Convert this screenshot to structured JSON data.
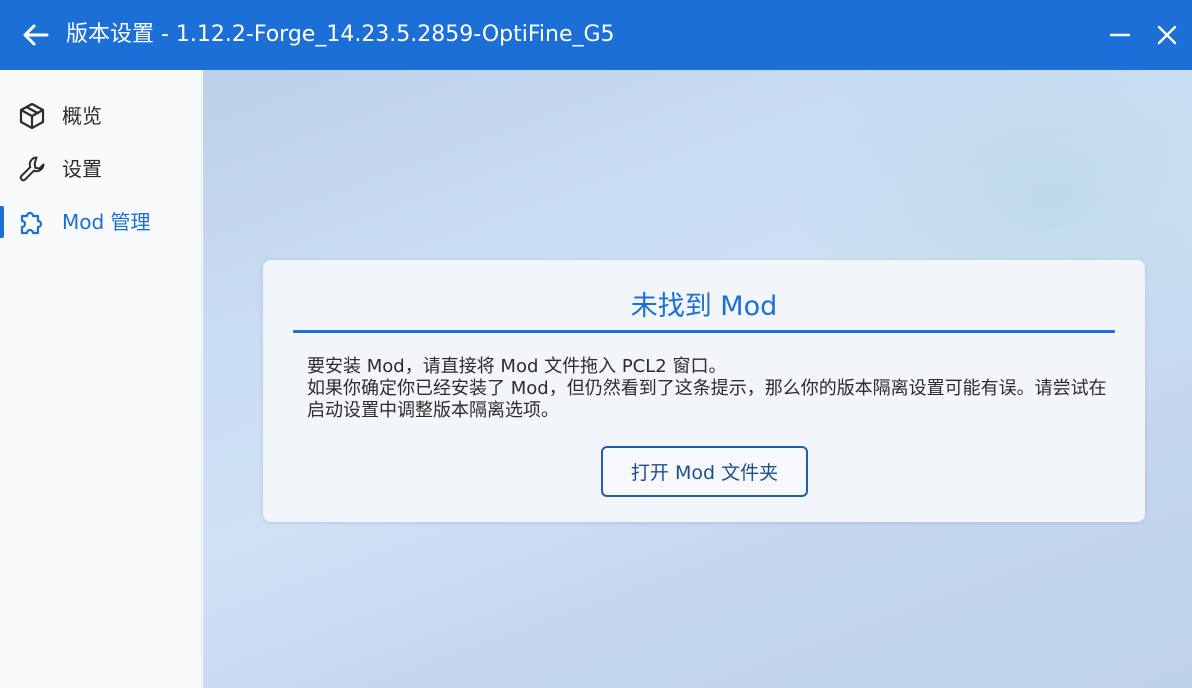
{
  "window": {
    "title": "版本设置 - 1.12.2-Forge_14.23.5.2859-OptiFine_G5",
    "accent_color": "#1b6fd6"
  },
  "sidebar": {
    "items": [
      {
        "label": "概览",
        "icon": "cube-icon",
        "active": false
      },
      {
        "label": "设置",
        "icon": "wrench-icon",
        "active": false
      },
      {
        "label": "Mod 管理",
        "icon": "puzzle-icon",
        "active": true
      }
    ]
  },
  "card": {
    "title": "未找到 Mod",
    "line1": "要安装 Mod，请直接将 Mod 文件拖入 PCL2 窗口。",
    "line2": "如果你确定你已经安装了 Mod，但仍然看到了这条提示，那么你的版本隔离设置可能有误。请尝试在启动设置中调整版本隔离选项。",
    "button_label": "打开 Mod 文件夹"
  }
}
